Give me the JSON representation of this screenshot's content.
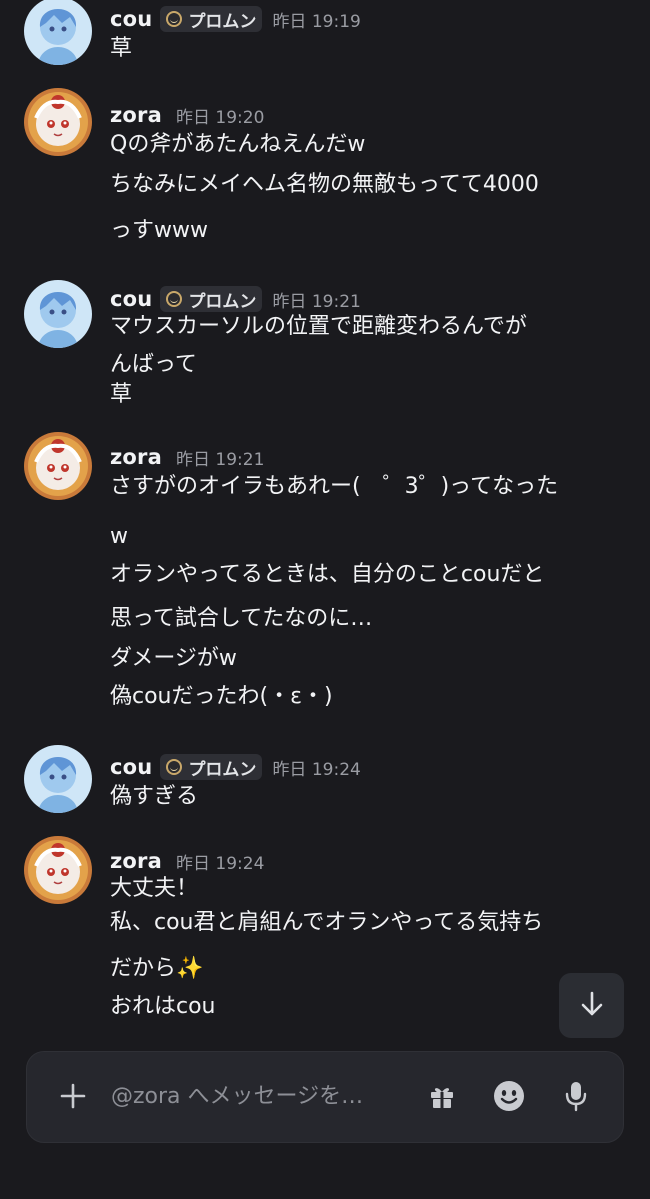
{
  "messages": [
    {
      "user": "cou",
      "tag": "プロムン",
      "time": "昨日 19:19",
      "lines": [
        "草"
      ]
    },
    {
      "user": "zora",
      "time": "昨日 19:20",
      "lines": [
        "Qの斧があたんねえんだw",
        "ちなみにメイヘム名物の無敵もってて4000",
        "っすwww"
      ]
    },
    {
      "user": "cou",
      "tag": "プロムン",
      "time": "昨日 19:21",
      "lines": [
        "マウスカーソルの位置で距離変わるんでが",
        "んばって",
        "草"
      ]
    },
    {
      "user": "zora",
      "time": "昨日 19:21",
      "lines": [
        "さすがのオイラもあれー(　゜3゜)ってなった",
        "w",
        "オランやってるときは、自分のことcouだと",
        "思って試合してたなのに…",
        "ダメージがw",
        "偽couだったわ(・ε・)"
      ]
    },
    {
      "user": "cou",
      "tag": "プロムン",
      "time": "昨日 19:24",
      "lines": [
        "偽すぎる"
      ]
    },
    {
      "user": "zora",
      "time": "昨日 19:24",
      "lines": [
        "大丈夫！",
        "私、cou君と肩組んでオランやってる気持ち",
        "だから✨",
        "おれはcou"
      ]
    }
  ],
  "composer": {
    "placeholder": "@zora へメッセージを…"
  },
  "icons": {
    "add": "plus-icon",
    "gift": "gift-icon",
    "emoji": "emoji-icon",
    "mic": "microphone-icon",
    "scroll": "arrow-down-icon",
    "tag": "moon-badge-icon"
  },
  "colors": {
    "background": "#1a1a1e",
    "text": "#f2f3f5",
    "muted": "#9a9ca3",
    "composer": "#26272d"
  }
}
